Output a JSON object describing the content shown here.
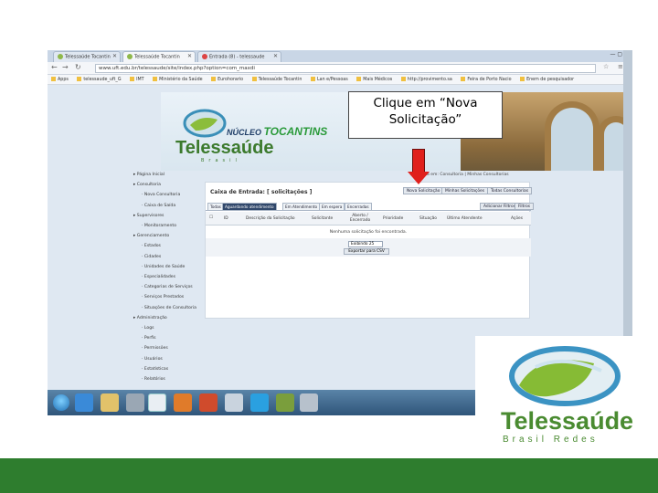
{
  "browser": {
    "tabs": [
      {
        "label": "Telessaúde Tocantin",
        "active": false
      },
      {
        "label": "Telessaúde Tocantin",
        "active": true
      },
      {
        "label": "Entrada (8) - telessaude",
        "active": false
      }
    ],
    "url": "www.uft.edu.br/telessaude/site/index.php?option=com_maxdi",
    "bookmarks": [
      "Apps",
      "telessaude_uft_G",
      "IMT",
      "Ministério da Saúde",
      "Eurohorario",
      "Telessaúde Tocantin",
      "Lan e/Pessoas",
      "Mais Médicos",
      "http://provimento.sa",
      "Feira de Porto Nacio",
      "Enem de pesquisador"
    ]
  },
  "site": {
    "logo_text": "Telessaúde",
    "logo_sub": "Brasil",
    "nucleo": "NÚCLEO",
    "tocantins": "TOCANTINS"
  },
  "sidebar": {
    "items": [
      {
        "label": "Página Inicial",
        "sub": false
      },
      {
        "label": "Consultoria",
        "sub": false
      },
      {
        "label": "Nova Consultoria",
        "sub": true
      },
      {
        "label": "Caixa de Saída",
        "sub": true
      },
      {
        "label": "Supervisores",
        "sub": false
      },
      {
        "label": "Monitoramento",
        "sub": true
      },
      {
        "label": "Gerenciamento",
        "sub": false
      },
      {
        "label": "Estados",
        "sub": true
      },
      {
        "label": "Cidades",
        "sub": true
      },
      {
        "label": "Unidades de Saúde",
        "sub": true
      },
      {
        "label": "Especialidades",
        "sub": true
      },
      {
        "label": "Categorias de Serviços",
        "sub": true
      },
      {
        "label": "Serviços Prestados",
        "sub": true
      },
      {
        "label": "Situações de Consultoria",
        "sub": true
      },
      {
        "label": "Administração",
        "sub": false
      },
      {
        "label": "Logs",
        "sub": true
      },
      {
        "label": "Perfis",
        "sub": true
      },
      {
        "label": "Permissões",
        "sub": true
      },
      {
        "label": "Usuários",
        "sub": true
      },
      {
        "label": "Estatísticas",
        "sub": true
      },
      {
        "label": "Relatórios",
        "sub": true
      }
    ]
  },
  "content": {
    "breadcrumb": "Você está em: Consultoria | Minhas Consultorias",
    "title": "Caixa de Entrada: [ solicitações ]",
    "top_buttons": [
      "Nova Solicitação",
      "Minhas Solicitações",
      "Todas Consultorias"
    ],
    "tabs": [
      "Todas",
      "Aguardando atendimento",
      "Em Atendimento",
      "Em espera",
      "Encerradas"
    ],
    "right_buttons": [
      "Adicionar Filtros",
      "Filtros"
    ],
    "columns": [
      "ID",
      "Descrição da Solicitação",
      "Solicitante",
      "Aberto / Encerrado",
      "Prioridade",
      "Situação",
      "Último Atendente",
      "Ações"
    ],
    "empty_message": "Nenhuma solicitação foi encontrada.",
    "page_size": "Exibindo 25",
    "export_label": "Exportar para CSV"
  },
  "callout": {
    "text": "Clique em “Nova Solicitação”"
  },
  "big_logo": {
    "title": "Telessaúde",
    "subtitle": "Brasil Redes"
  },
  "colors": {
    "arrow": "#e0201c",
    "brand_green": "#4a8b31",
    "footer_green": "#2e7d2e"
  }
}
